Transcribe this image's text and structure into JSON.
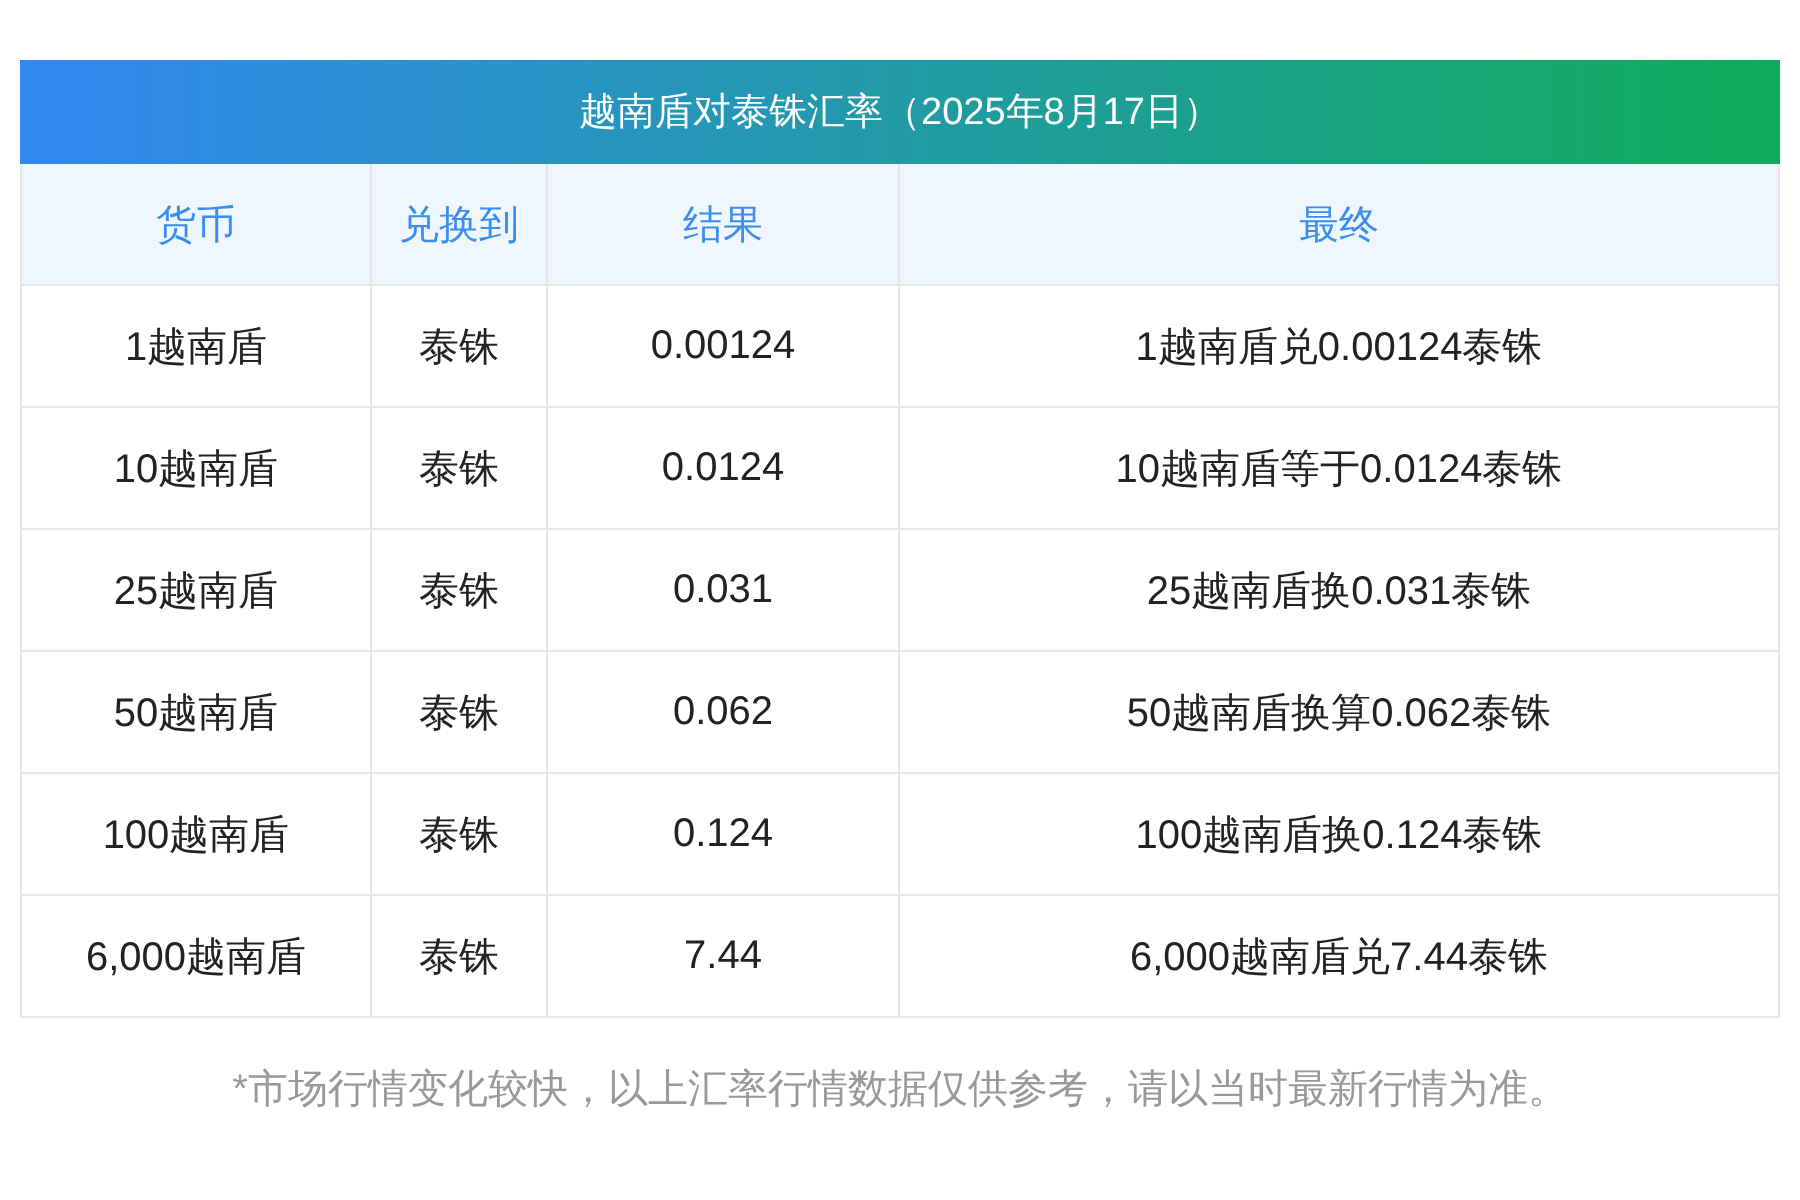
{
  "title": "越南盾对泰铢汇率（2025年8月17日）",
  "columns": [
    "货币",
    "兑换到",
    "结果",
    "最终"
  ],
  "rows": [
    [
      "1越南盾",
      "泰铢",
      "0.00124",
      "1越南盾兑0.00124泰铢"
    ],
    [
      "10越南盾",
      "泰铢",
      "0.0124",
      "10越南盾等于0.0124泰铢"
    ],
    [
      "25越南盾",
      "泰铢",
      "0.031",
      "25越南盾换0.031泰铢"
    ],
    [
      "50越南盾",
      "泰铢",
      "0.062",
      "50越南盾换算0.062泰铢"
    ],
    [
      "100越南盾",
      "泰铢",
      "0.124",
      "100越南盾换0.124泰铢"
    ],
    [
      "6,000越南盾",
      "泰铢",
      "7.44",
      "6,000越南盾兑7.44泰铢"
    ]
  ],
  "note": "*市场行情变化较快，以上汇率行情数据仅供参考，请以当时最新行情为准。"
}
